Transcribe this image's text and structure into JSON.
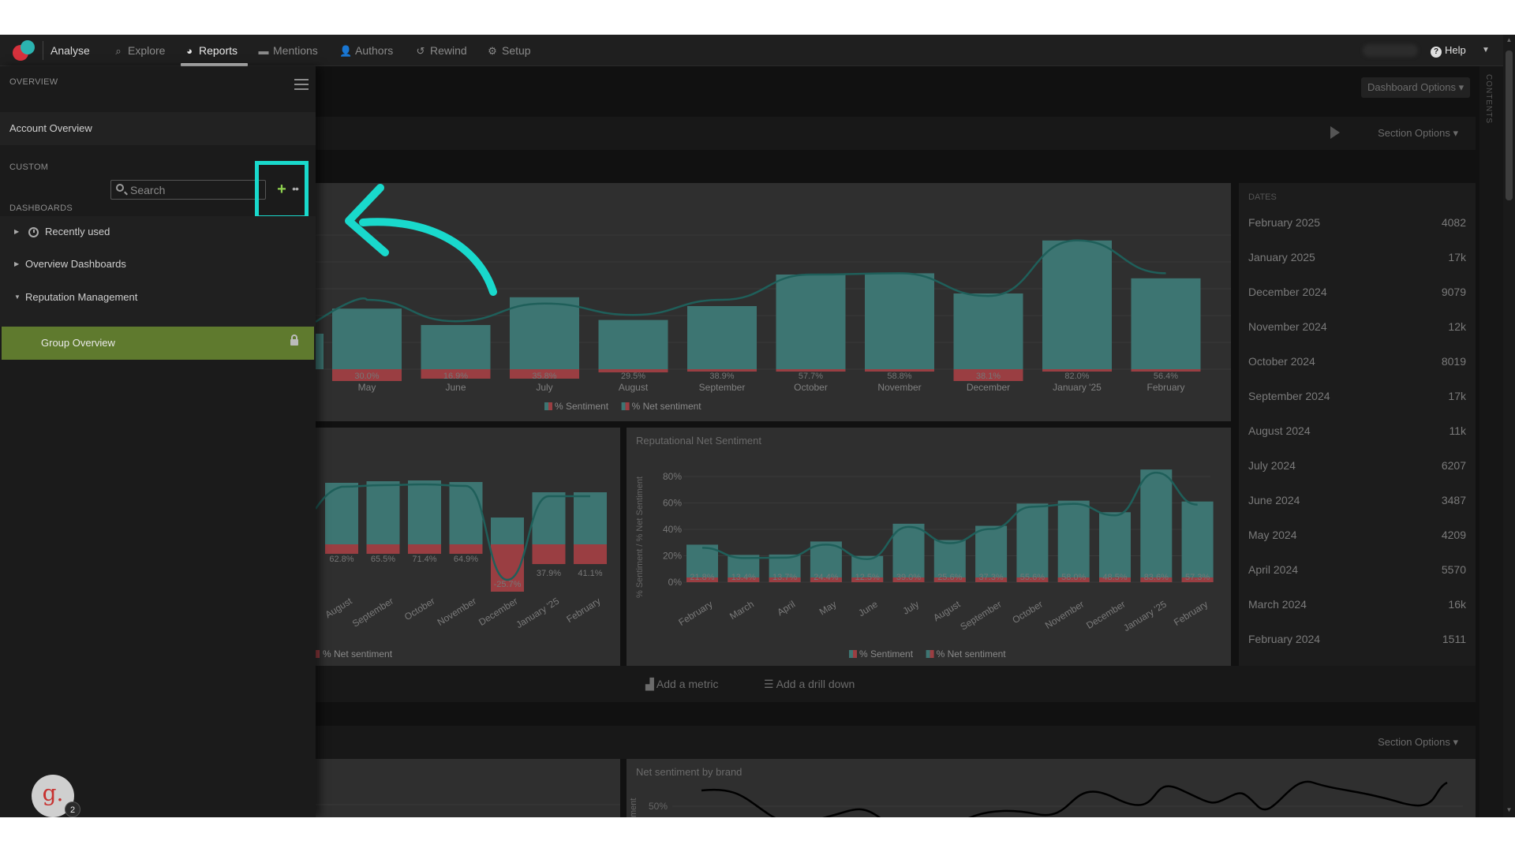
{
  "nav": {
    "brand": "Analyse",
    "items": [
      {
        "label": "Explore",
        "icon": "search-icon"
      },
      {
        "label": "Reports",
        "icon": "pie-chart-icon",
        "active": true
      },
      {
        "label": "Mentions",
        "icon": "comment-icon"
      },
      {
        "label": "Authors",
        "icon": "user-icon"
      },
      {
        "label": "Rewind",
        "icon": "history-icon"
      },
      {
        "label": "Setup",
        "icon": "gear-icon"
      }
    ],
    "help": "Help"
  },
  "sidebar": {
    "overview_label": "OVERVIEW",
    "account_overview": "Account Overview",
    "custom_label": "CUSTOM",
    "search_placeholder": "Search",
    "dashboards_label": "DASHBOARDS",
    "tree": [
      {
        "label": "Recently used",
        "expanded": false
      },
      {
        "label": "Overview Dashboards",
        "expanded": false
      },
      {
        "label": "Reputation Management",
        "expanded": true
      }
    ],
    "selected": "Group Overview"
  },
  "avatar": {
    "letter": "g.",
    "badge": "2"
  },
  "main": {
    "dashboard_options": "Dashboard Options ▾",
    "section_options": "Section Options ▾",
    "contents_label": "CONTENTS",
    "add_metric": "Add a metric",
    "add_drilldown": "Add a drill down",
    "dates_header": "DATES",
    "dates": [
      {
        "date": "February 2025",
        "value": "4082"
      },
      {
        "date": "January 2025",
        "value": "17k"
      },
      {
        "date": "December 2024",
        "value": "9079"
      },
      {
        "date": "November 2024",
        "value": "12k"
      },
      {
        "date": "October 2024",
        "value": "8019"
      },
      {
        "date": "September 2024",
        "value": "17k"
      },
      {
        "date": "August 2024",
        "value": "11k"
      },
      {
        "date": "July 2024",
        "value": "6207"
      },
      {
        "date": "June 2024",
        "value": "3487"
      },
      {
        "date": "May 2024",
        "value": "4209"
      },
      {
        "date": "April 2024",
        "value": "5570"
      },
      {
        "date": "March 2024",
        "value": "16k"
      },
      {
        "date": "February 2024",
        "value": "1511"
      }
    ],
    "legend_sentiment": "% Sentiment",
    "legend_net": "% Net sentiment",
    "net_sentiment_by_brand": "Net sentiment by brand",
    "brand_tick": "50%",
    "brand_axis_fragment": "ment"
  },
  "colors": {
    "accent": "#19d9cc",
    "selected_bg": "#5f7a2e",
    "add_green": "#8fd14f",
    "bar_teal": "#3d7572",
    "bar_red": "#9a3e42"
  },
  "chart_data": [
    {
      "type": "bar",
      "categories": [
        "May",
        "June",
        "July",
        "August",
        "September",
        "October",
        "November",
        "December",
        "January '25",
        "February"
      ],
      "data_labels": [
        "30.0%",
        "16.9%",
        "35.8%",
        "29.5%",
        "38.9%",
        "57.7%",
        "58.8%",
        "38.1%",
        "82.0%",
        "56.4%"
      ],
      "series": [
        {
          "name": "% Sentiment",
          "values": [
            48,
            35,
            57,
            39,
            50,
            75,
            76,
            60,
            102,
            72
          ]
        }
      ],
      "line": [
        55,
        38,
        52,
        43,
        55,
        75,
        76,
        58,
        102,
        76
      ],
      "legend": [
        "% Sentiment",
        "% Net sentiment"
      ]
    },
    {
      "type": "bar",
      "categories": [
        "August",
        "September",
        "October",
        "November",
        "December",
        "January '25",
        "February"
      ],
      "data_labels": [
        "62.8%",
        "65.5%",
        "71.4%",
        "64.9%",
        "-25.7%",
        "37.9%",
        "41.1%"
      ],
      "values": [
        62.8,
        65.5,
        71.4,
        64.9,
        -25.7,
        37.9,
        41.1
      ],
      "legend": [
        "% Net sentiment"
      ]
    },
    {
      "type": "bar",
      "title": "Reputational Net Sentiment",
      "ylabel": "% Sentiment / % Net Sentiment",
      "yticks": [
        "80%",
        "60%",
        "40%",
        "20%",
        "0%"
      ],
      "ylim": [
        0,
        80
      ],
      "categories": [
        "February",
        "March",
        "April",
        "May",
        "June",
        "July",
        "August",
        "September",
        "October",
        "November",
        "December",
        "January '25",
        "February"
      ],
      "data_labels": [
        "21.8%",
        "13.4%",
        "13.7%",
        "24.4%",
        "12.5%",
        "39.0%",
        "25.6%",
        "37.3%",
        "55.6%",
        "58.0%",
        "48.5%",
        "83.6%",
        "57.3%"
      ],
      "values": [
        21.8,
        13.4,
        13.7,
        24.4,
        12.5,
        39.0,
        25.6,
        37.3,
        55.6,
        58.0,
        48.5,
        83.6,
        57.3
      ],
      "legend": [
        "% Sentiment",
        "% Net sentiment"
      ]
    }
  ]
}
